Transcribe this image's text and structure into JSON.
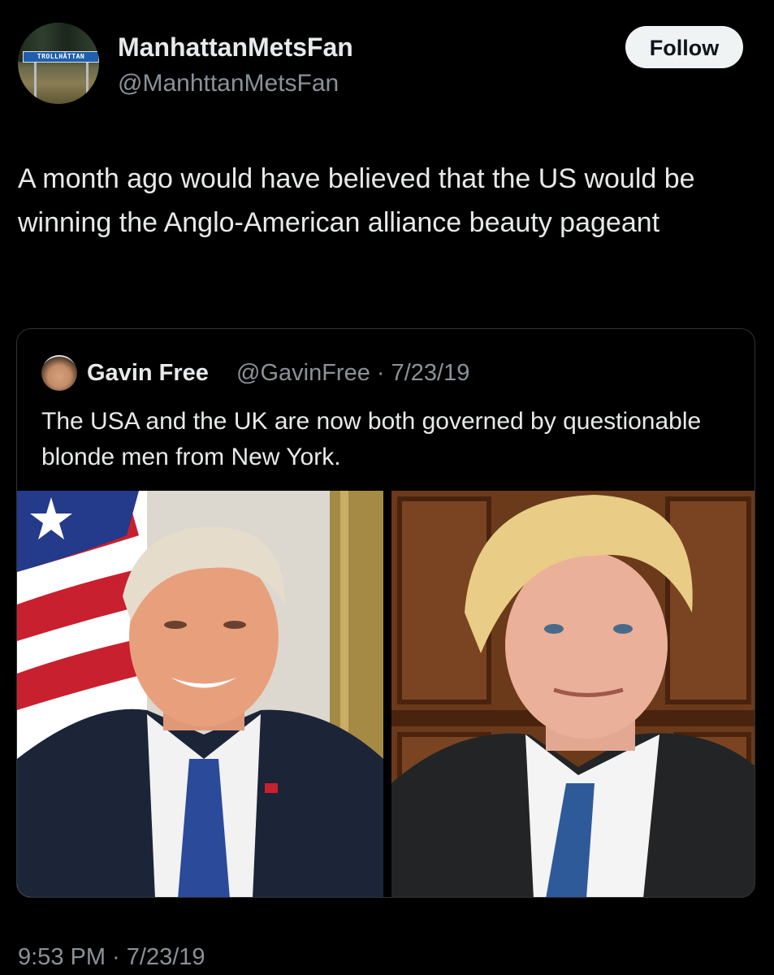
{
  "author": {
    "display_name": "ManhattanMetsFan",
    "handle": "@ManhttanMetsFan",
    "avatar_sign_text": "TROLLHÄTTAN"
  },
  "follow_button": {
    "label": "Follow"
  },
  "tweet": {
    "text": "A month ago would have believed that the US would be winning the Anglo-American alliance beauty pageant",
    "timestamp": "9:53 PM · 7/23/19"
  },
  "quoted_tweet": {
    "display_name": "Gavin Free",
    "meta": "@GavinFree · 7/23/19",
    "text": "The USA and the UK are now both governed by questionable blonde men from New York."
  },
  "colors": {
    "background": "#000000",
    "primary_text": "#e7e9ea",
    "secondary_text": "#8b9198",
    "card_border": "#2f3336",
    "follow_bg": "#eff3f4"
  }
}
